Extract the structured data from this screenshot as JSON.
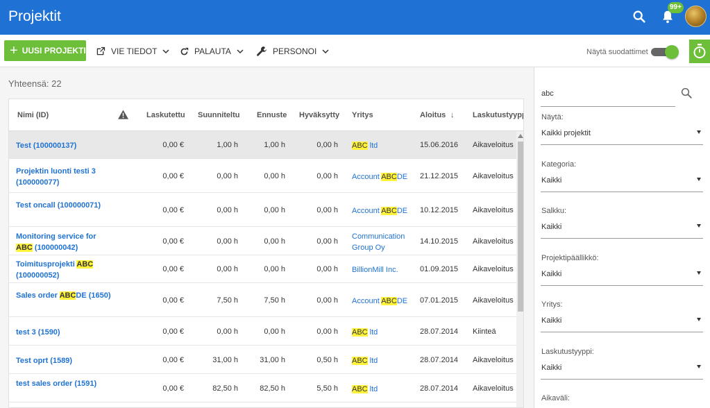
{
  "header": {
    "title": "Projektit",
    "notification_count": "99+"
  },
  "toolbar": {
    "new_project": "UUSI PROJEKTI",
    "export": "VIE TIEDOT",
    "restore": "PALAUTA",
    "personalize": "PERSONOI",
    "show_filters": "Näytä suodattimet"
  },
  "main": {
    "total": "Yhteensä: 22"
  },
  "table": {
    "columns": {
      "name": "Nimi (ID)",
      "billed": "Laskutettu",
      "planned": "Suunniteltu",
      "forecast": "Ennuste",
      "approved": "Hyväksytty",
      "company": "Yritys",
      "start": "Aloitus",
      "billing_type": "Laskutustyypp"
    },
    "rows": [
      {
        "name_pre": "Test (100000137)",
        "name_hl": "",
        "name_post": "",
        "billed": "0,00 €",
        "planned": "1,00 h",
        "forecast": "1,00 h",
        "approved": "0,00 h",
        "comp_pre": "",
        "comp_hl": "ABC",
        "comp_post": " ltd",
        "start": "15.06.2016",
        "type": "Aikaveloitus"
      },
      {
        "name_pre": "Projektin luonti testi 3 (100000077)",
        "name_hl": "",
        "name_post": "",
        "billed": "0,00 €",
        "planned": "0,00 h",
        "forecast": "0,00 h",
        "approved": "0,00 h",
        "comp_pre": "Account ",
        "comp_hl": "ABC",
        "comp_post": "DE",
        "start": "21.12.2015",
        "type": "Aikaveloitus"
      },
      {
        "name_pre": "Test oncall (100000071)",
        "name_hl": "",
        "name_post": "",
        "billed": "0,00 €",
        "planned": "0,00 h",
        "forecast": "0,00 h",
        "approved": "0,00 h",
        "comp_pre": "Account ",
        "comp_hl": "ABC",
        "comp_post": "DE",
        "start": "10.12.2015",
        "type": "Aikaveloitus"
      },
      {
        "name_pre": "Monitoring service for ",
        "name_hl": "ABC",
        "name_post": " (100000042)",
        "billed": "0,00 €",
        "planned": "0,00 h",
        "forecast": "0,00 h",
        "approved": "0,00 h",
        "comp_pre": "Communication Group Oy",
        "comp_hl": "",
        "comp_post": "",
        "start": "14.10.2015",
        "type": "Aikaveloitus"
      },
      {
        "name_pre": "Toimitusprojekti ",
        "name_hl": "ABC",
        "name_post": " (100000052)",
        "billed": "0,00 €",
        "planned": "0,00 h",
        "forecast": "0,00 h",
        "approved": "0,00 h",
        "comp_pre": "BillionMill Inc.",
        "comp_hl": "",
        "comp_post": "",
        "start": "01.09.2015",
        "type": "Aikaveloitus"
      },
      {
        "name_pre": "Sales order ",
        "name_hl": "ABC",
        "name_post": "DE (1650)",
        "billed": "0,00 €",
        "planned": "7,50 h",
        "forecast": "7,50 h",
        "approved": "0,00 h",
        "comp_pre": "Account ",
        "comp_hl": "ABC",
        "comp_post": "DE",
        "start": "07.01.2015",
        "type": "Aikaveloitus"
      },
      {
        "name_pre": "test 3 (1590)",
        "name_hl": "",
        "name_post": "",
        "billed": "0,00 €",
        "planned": "0,00 h",
        "forecast": "0,00 h",
        "approved": "0,00 h",
        "comp_pre": "",
        "comp_hl": "ABC",
        "comp_post": " ltd",
        "start": "28.07.2014",
        "type": "Kiinteä"
      },
      {
        "name_pre": "Test oprt (1589)",
        "name_hl": "",
        "name_post": "",
        "billed": "0,00 €",
        "planned": "31,00 h",
        "forecast": "31,00 h",
        "approved": "0,50 h",
        "comp_pre": "",
        "comp_hl": "ABC",
        "comp_post": " ltd",
        "start": "28.07.2014",
        "type": "Aikaveloitus"
      },
      {
        "name_pre": "test sales order (1591)",
        "name_hl": "",
        "name_post": "",
        "billed": "0,00 €",
        "planned": "82,50 h",
        "forecast": "82,50 h",
        "approved": "5,50 h",
        "comp_pre": "",
        "comp_hl": "ABC",
        "comp_post": " ltd",
        "start": "28.07.2014",
        "type": "Aikaveloitus"
      }
    ]
  },
  "side": {
    "search_value": "abc",
    "filters": [
      {
        "label": "Näytä:",
        "value": "Kaikki projektit"
      },
      {
        "label": "Kategoria:",
        "value": "Kaikki"
      },
      {
        "label": "Salkku:",
        "value": "Kaikki"
      },
      {
        "label": "Projektipäällikkö:",
        "value": "Kaikki"
      },
      {
        "label": "Yritys:",
        "value": "Kaikki"
      },
      {
        "label": "Laskutustyyppi:",
        "value": "Kaikki"
      },
      {
        "label": "Aikaväli:",
        "value": ""
      }
    ]
  },
  "colors": {
    "primary": "#1f72d3",
    "accent": "#6dbf3a",
    "highlight": "#fff23a"
  },
  "icons": [
    "search-icon",
    "bell-icon",
    "plus-icon",
    "export-icon",
    "refresh-icon",
    "wrench-icon",
    "chevron-down-icon",
    "stopwatch-icon",
    "warning-icon",
    "sort-arrow-icon"
  ]
}
